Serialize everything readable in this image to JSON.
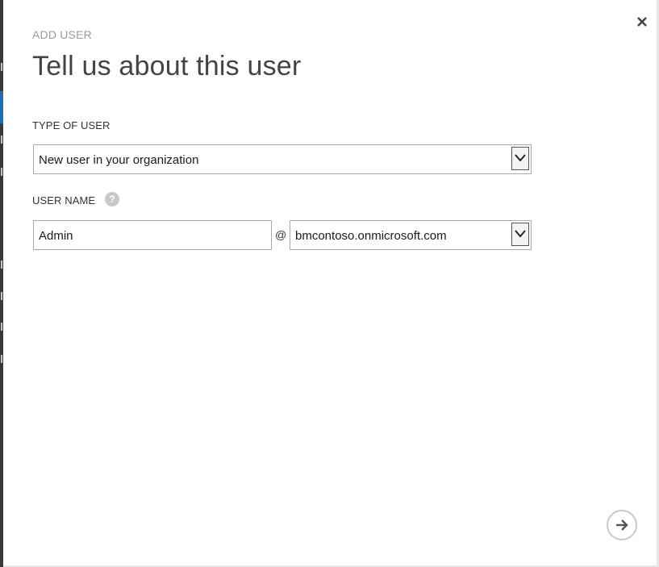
{
  "dialog": {
    "subtitle": "ADD USER",
    "title": "Tell us about this user",
    "close_icon": "close-icon",
    "next_icon": "arrow-right-icon"
  },
  "type_of_user": {
    "label": "TYPE OF USER",
    "selected": "New user in your organization"
  },
  "user_name": {
    "label": "USER NAME",
    "help_icon": "help-icon",
    "help_glyph": "?",
    "value": "Admin",
    "at": "@",
    "domain_selected": "bmcontoso.onmicrosoft.com"
  },
  "colors": {
    "title": "#444444",
    "subtitle": "#9a9a9a",
    "border": "#a9a9a9"
  }
}
